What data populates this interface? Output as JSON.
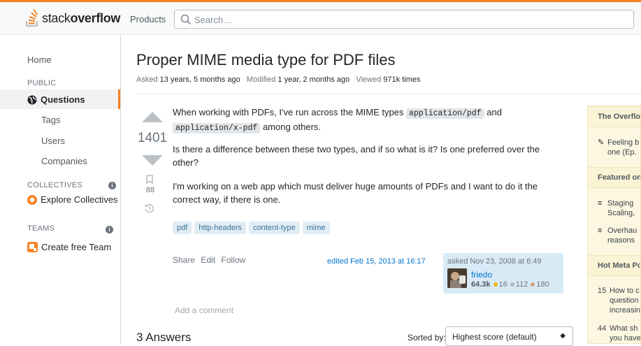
{
  "header": {
    "logo_text_light": "stack",
    "logo_text_bold": "overflow",
    "products_label": "Products",
    "search_placeholder": "Search…"
  },
  "nav": {
    "home": "Home",
    "public_label": "PUBLIC",
    "questions": "Questions",
    "tags": "Tags",
    "users": "Users",
    "companies": "Companies",
    "collectives_label": "COLLECTIVES",
    "explore_collectives": "Explore Collectives",
    "teams_label": "TEAMS",
    "create_team": "Create free Team",
    "info_glyph": "i"
  },
  "question": {
    "title": "Proper MIME media type for PDF files",
    "asked_label": "Asked",
    "asked_value": "13 years, 5 months ago",
    "modified_label": "Modified",
    "modified_value": "1 year, 2 months ago",
    "viewed_label": "Viewed",
    "viewed_value": "971k times",
    "votes": "1401",
    "bookmarks": "88",
    "body": {
      "p1_a": "When working with PDFs, I've run across the MIME types ",
      "p1_code1": "application/pdf",
      "p1_b": " and",
      "p1_code2": "application/x-pdf",
      "p1_c": " among others.",
      "p2": "Is there a difference between these two types, and if so what is it? Is one preferred over the other?",
      "p3": "I'm working on a web app which must deliver huge amounts of PDFs and I want to do it the correct way, if there is one."
    },
    "tags": [
      "pdf",
      "http-headers",
      "content-type",
      "mime"
    ],
    "share": "Share",
    "edit": "Edit",
    "follow": "Follow",
    "edited": "edited Feb 15, 2013 at 16:17",
    "asked_card": {
      "when": "asked Nov 23, 2008 at 6:49",
      "user": "friedo",
      "rep": "64.3k",
      "gold": "16",
      "silver": "112",
      "bronze": "180"
    },
    "add_comment": "Add a comment"
  },
  "answers": {
    "count_label": "3 Answers",
    "sorted_by": "Sorted by:",
    "sort_value": "Highest score (default)"
  },
  "sidebar": {
    "overflow_head": "The Overflow",
    "overflow_item_l1": "Feeling b",
    "overflow_item_l2": "one (Ep.",
    "featured_head": "Featured on",
    "featured1_l1": "Staging",
    "featured1_l2": "Scaling,",
    "featured2_l1": "Overhau",
    "featured2_l2": "reasons",
    "hot_head": "Hot Meta Po",
    "hot1_n": "15",
    "hot1_l1": "How to c",
    "hot1_l2": "question",
    "hot1_l3": "increasin",
    "hot2_n": "44",
    "hot2_l1": "What sh",
    "hot2_l2": "you have"
  },
  "colors": {
    "accent": "#f48225",
    "link": "#0074cc",
    "tag_bg": "#e1ecf4",
    "gold": "#f1b600",
    "silver": "#b4b8bc",
    "bronze": "#d1a684"
  }
}
